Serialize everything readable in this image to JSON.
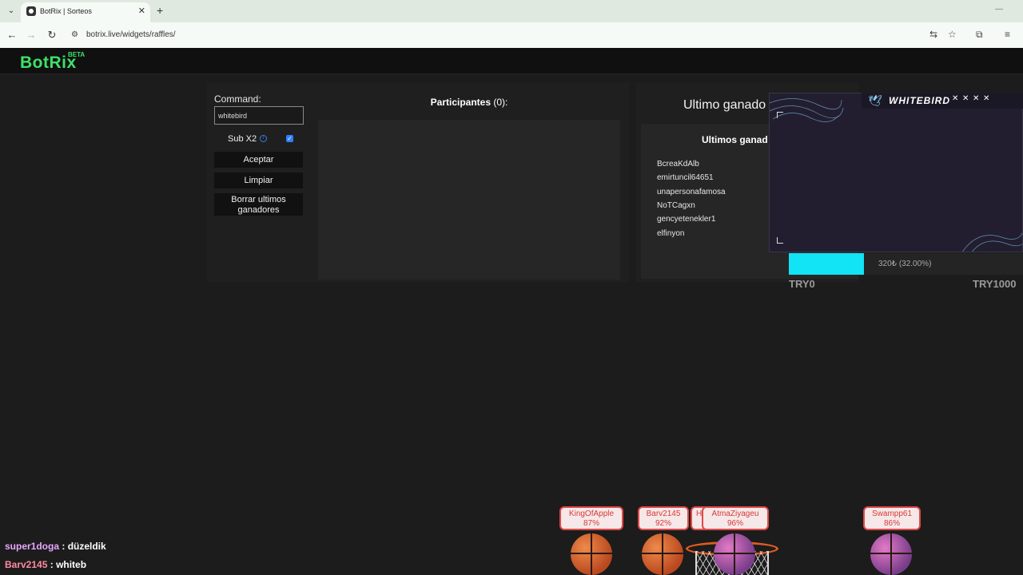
{
  "browser": {
    "tab_title": "BotRix | Sorteos",
    "url": "botrix.live/widgets/raffles/"
  },
  "app": {
    "logo": "BotRix",
    "logo_badge": "BETA",
    "accent_color": "#3ee06a"
  },
  "raffle": {
    "command_label": "Command:",
    "command_value": "whitebird",
    "sub_x2_label": "Sub X2",
    "sub_x2_checked": true,
    "accept_label": "Aceptar",
    "clear_label": "Limpiar",
    "erase_winners_label": "Borrar ultimos ganadores",
    "participants_label": "Participantes",
    "participants_count": "(0):"
  },
  "winners": {
    "last_winner_title": "Ultimo ganado",
    "last_winners_title": "Ultimos ganad",
    "list": [
      "BcreaKdAlb",
      "emirtuncil64651",
      "unapersonafamosa",
      "NoTCagxn",
      "gencyetenekler1",
      "elfinyon"
    ]
  },
  "overlay": {
    "brand": "WHITEBIRD",
    "progress_text": "320₺ (32.00%)",
    "progress_fraction": 0.32,
    "progress_color": "#12e3f5",
    "min_label": "TRY0",
    "max_label": "TRY1000"
  },
  "chat": [
    {
      "user": "super1doga",
      "sep": " : ",
      "msg": "düzeldik",
      "color": "#e8a6ff"
    },
    {
      "user": "Barv2145",
      "sep": " : ",
      "msg": "whiteb",
      "color": "#ff8aa0"
    }
  ],
  "players": [
    {
      "name": "KingOfApple",
      "pct": "87%",
      "ball": "orange"
    },
    {
      "name": "Barv2145",
      "pct": "92%",
      "ball": "orange"
    },
    {
      "name": "H",
      "pct": "",
      "ball": "none"
    },
    {
      "name": "AtmaZiyageu",
      "pct": "96%",
      "ball": "purple"
    },
    {
      "name": "Swampp61",
      "pct": "86%",
      "ball": "purple"
    }
  ]
}
